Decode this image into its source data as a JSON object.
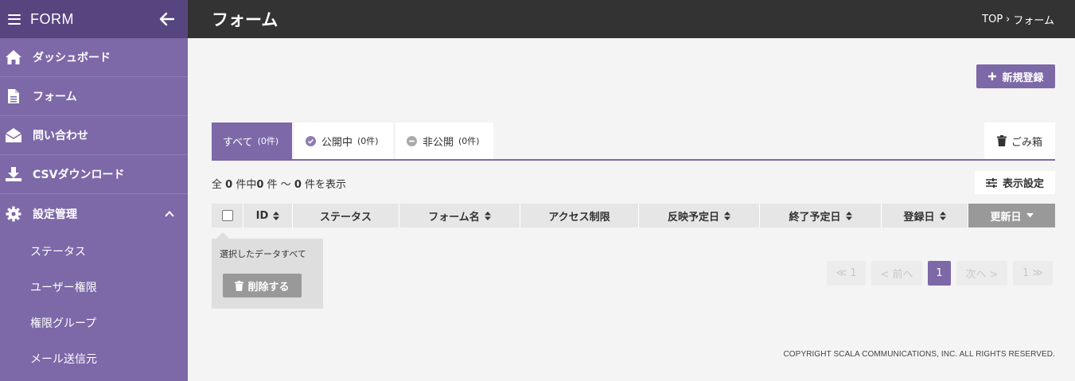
{
  "sidebar": {
    "title": "FORM",
    "items": [
      {
        "label": "ダッシュボード",
        "icon": "home-icon"
      },
      {
        "label": "フォーム",
        "icon": "document-icon"
      },
      {
        "label": "問い合わせ",
        "icon": "envelope-open-icon"
      },
      {
        "label": "CSVダウンロード",
        "icon": "download-icon"
      },
      {
        "label": "設定管理",
        "icon": "gear-icon",
        "expanded": true
      }
    ],
    "subitems": [
      "ステータス",
      "ユーザー権限",
      "権限グループ",
      "メール送信元"
    ]
  },
  "header": {
    "title": "フォーム",
    "breadcrumb": {
      "home": "TOP",
      "separator": "›",
      "current": "フォーム"
    }
  },
  "actions": {
    "new_label": "新規登録"
  },
  "tabs": [
    {
      "label": "すべて",
      "count": "(0件)",
      "active": true
    },
    {
      "label": "公開中",
      "count": "(0件)",
      "icon": "check-circle-icon"
    },
    {
      "label": "非公開",
      "count": "(0件)",
      "icon": "minus-circle-icon"
    }
  ],
  "trash_label": "ごみ箱",
  "summary": {
    "p1": "全",
    "total": "0",
    "p2": "件中",
    "from": "0",
    "p3": "件 〜",
    "to": "0",
    "p4": "件を表示"
  },
  "display_settings_label": "表示設定",
  "table": {
    "columns": [
      "ID",
      "ステータス",
      "フォーム名",
      "アクセス制限",
      "反映予定日",
      "終了予定日",
      "登録日",
      "更新日"
    ]
  },
  "bulk": {
    "text": "選択したデータすべて",
    "delete_label": "削除する"
  },
  "pager": {
    "first": "≪ 1",
    "prev": "< 前へ",
    "current": "1",
    "next": "次へ >",
    "last": "1 ≫"
  },
  "footer": {
    "copyright": "COPYRIGHT SCALA COMMUNICATIONS, INC. ALL RIGHTS RESERVED."
  },
  "colors": {
    "accent": "#7d68a8",
    "header": "#333333",
    "sidebar_head": "#574580"
  }
}
